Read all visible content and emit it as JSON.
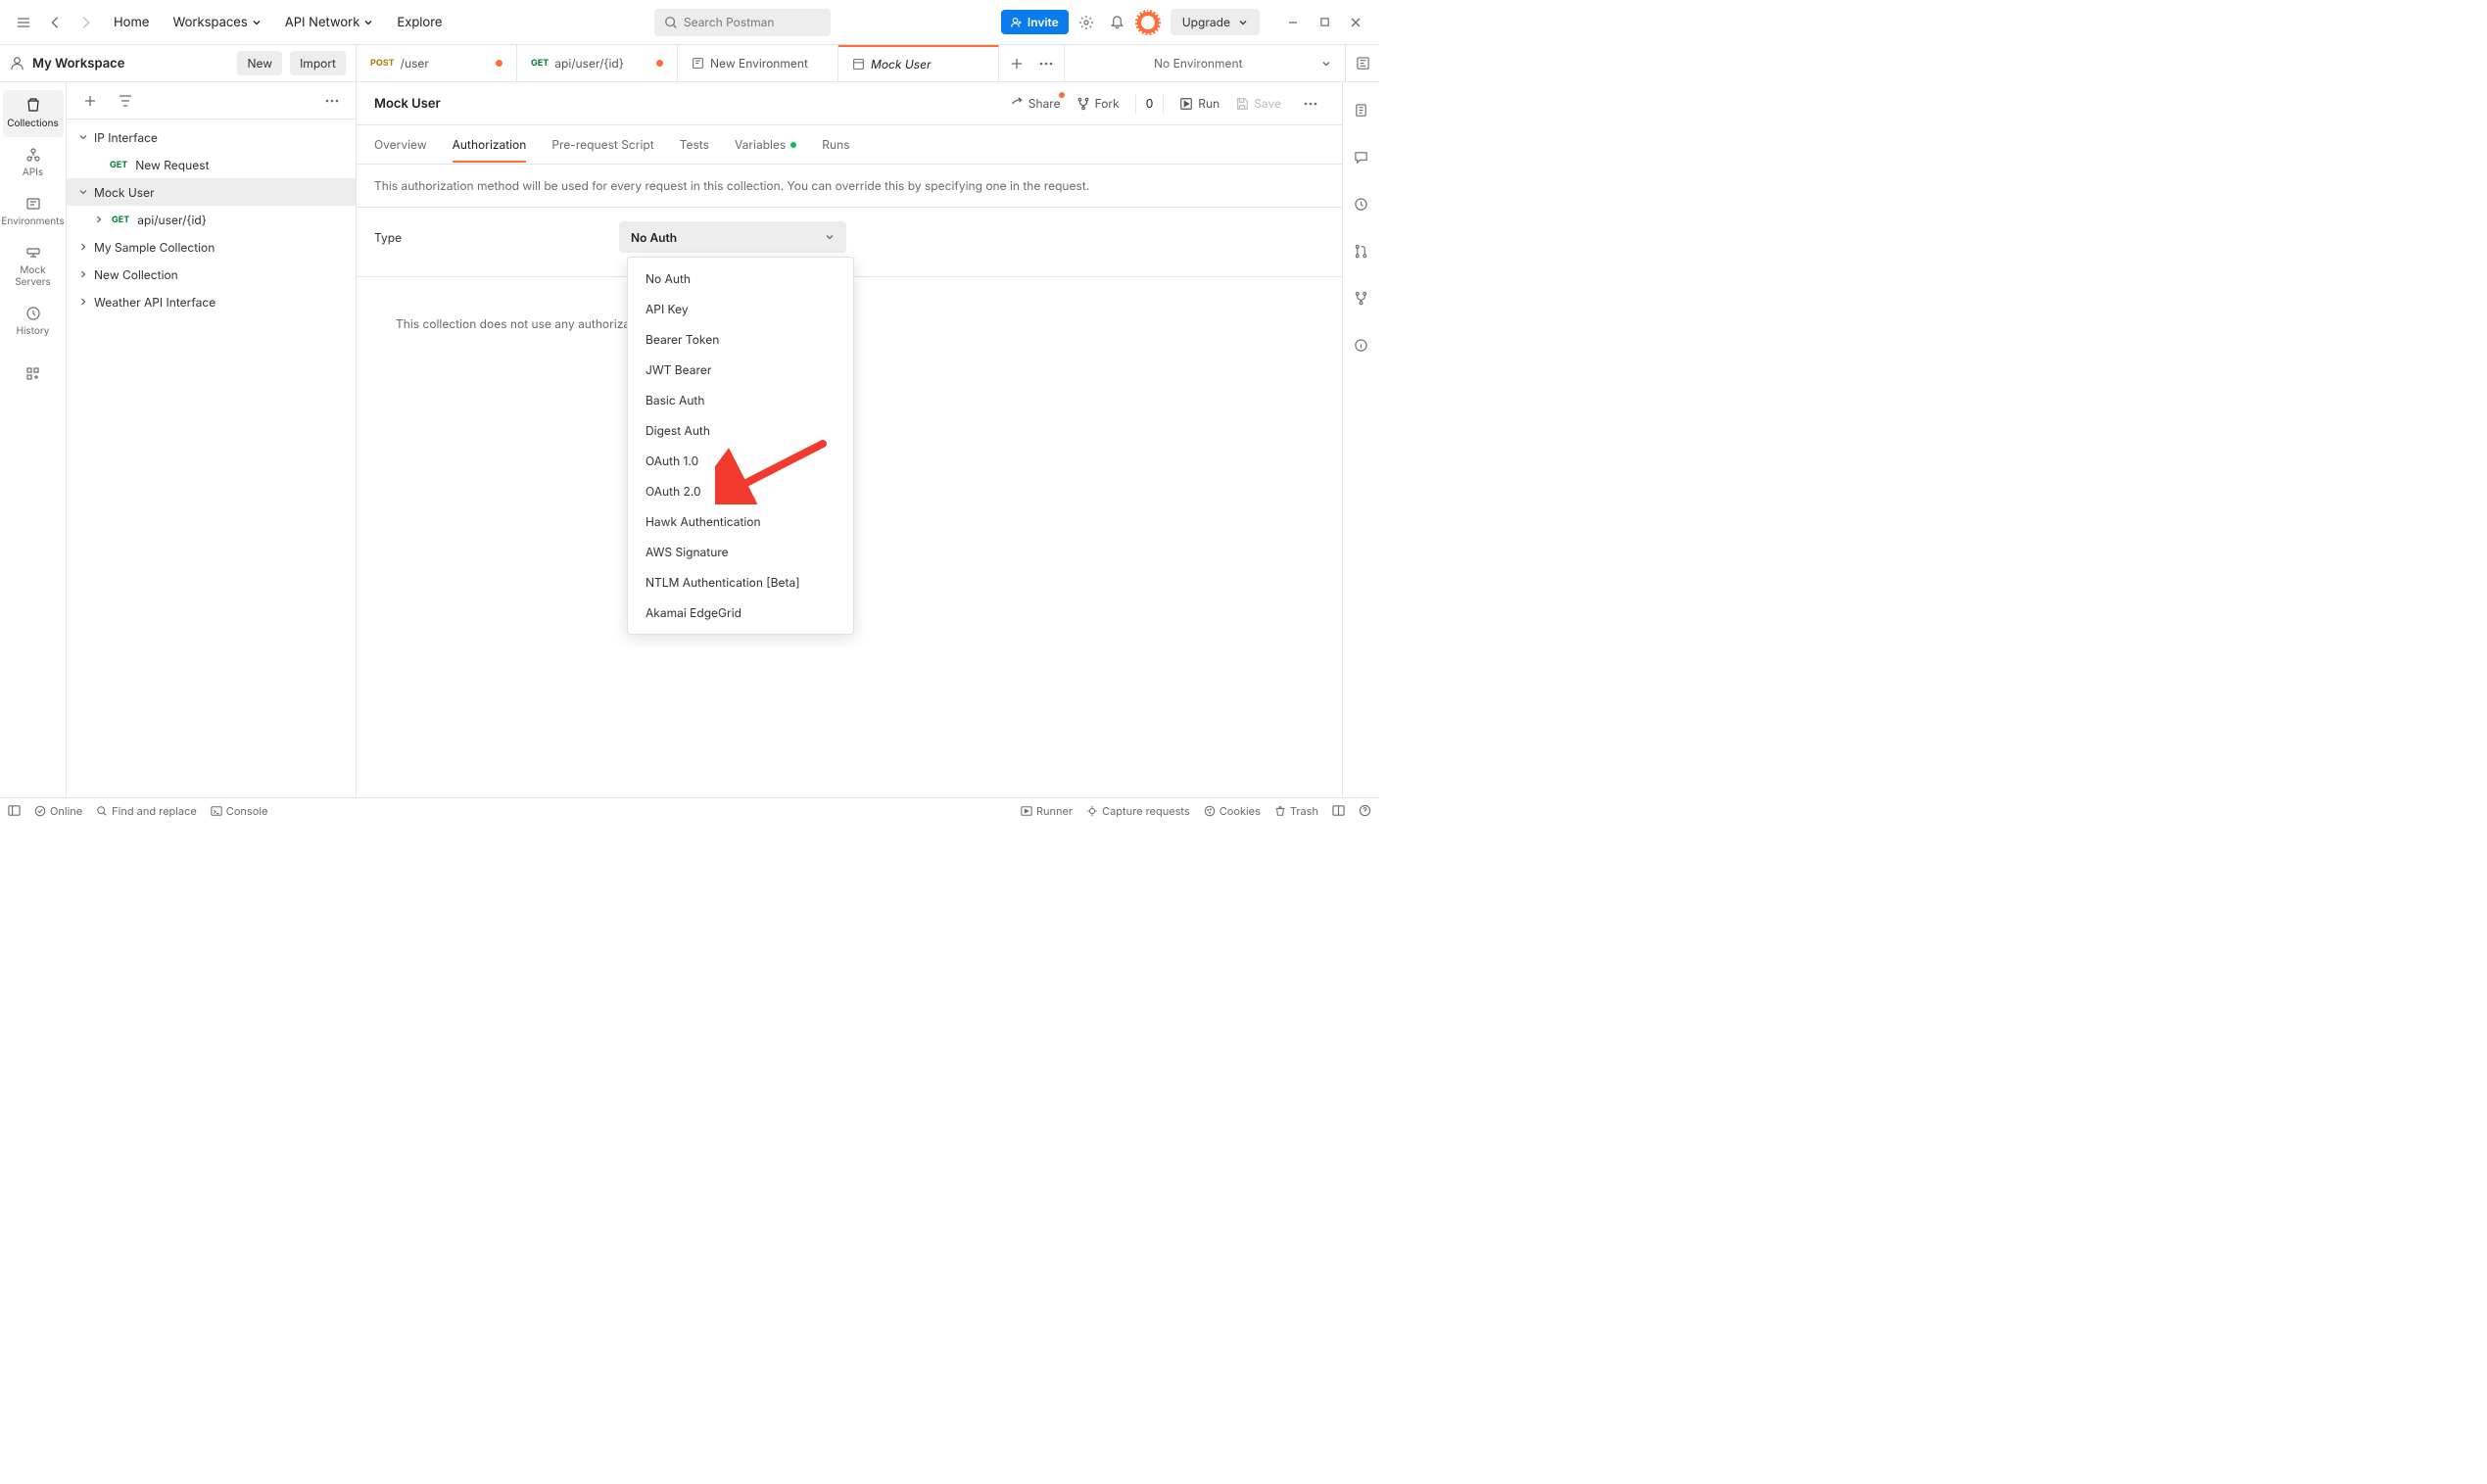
{
  "topnav": {
    "home": "Home",
    "workspaces": "Workspaces",
    "api_network": "API Network",
    "explore": "Explore",
    "search_placeholder": "Search Postman",
    "invite": "Invite",
    "upgrade": "Upgrade"
  },
  "workspace": {
    "title": "My Workspace",
    "new_btn": "New",
    "import_btn": "Import"
  },
  "tabs": [
    {
      "method": "POST",
      "method_color": "#AD7A03",
      "label": "/user",
      "dirty": true
    },
    {
      "method": "GET",
      "method_color": "#007F31",
      "label": "api/user/{id}",
      "dirty": true
    },
    {
      "icon": "env",
      "label": "New Environment",
      "dirty": false
    },
    {
      "icon": "collection",
      "label": "Mock User",
      "dirty": false,
      "active": true,
      "italic": true
    }
  ],
  "env_selector": "No Environment",
  "left_rail": [
    {
      "label": "Collections",
      "active": true
    },
    {
      "label": "APIs"
    },
    {
      "label": "Environments"
    },
    {
      "label": "Mock Servers"
    },
    {
      "label": "History"
    }
  ],
  "tree": [
    {
      "type": "folder",
      "label": "IP Interface",
      "expanded": true,
      "depth": 1
    },
    {
      "type": "request",
      "method": "GET",
      "label": "New Request",
      "depth": 2
    },
    {
      "type": "folder",
      "label": "Mock User",
      "expanded": true,
      "selected": true,
      "depth": 1
    },
    {
      "type": "folder-sub",
      "method": "GET",
      "label": "api/user/{id}",
      "depth": 2,
      "chev": true
    },
    {
      "type": "folder",
      "label": "My Sample Collection",
      "expanded": false,
      "depth": 1
    },
    {
      "type": "folder",
      "label": "New Collection",
      "expanded": false,
      "depth": 1
    },
    {
      "type": "folder",
      "label": "Weather API Interface",
      "expanded": false,
      "depth": 1
    }
  ],
  "main": {
    "title": "Mock User",
    "actions": {
      "share": "Share",
      "fork": "Fork",
      "fork_count": "0",
      "run": "Run",
      "save": "Save"
    },
    "subtabs": [
      {
        "label": "Overview"
      },
      {
        "label": "Authorization",
        "active": true
      },
      {
        "label": "Pre-request Script"
      },
      {
        "label": "Tests"
      },
      {
        "label": "Variables",
        "dot": true
      },
      {
        "label": "Runs"
      }
    ],
    "auth_desc": "This authorization method will be used for every request in this collection. You can override this by specifying one in the request.",
    "type_label": "Type",
    "type_value": "No Auth",
    "auth_empty": "This collection does not use any authoriza",
    "auth_dropdown": [
      "No Auth",
      "API Key",
      "Bearer Token",
      "JWT Bearer",
      "Basic Auth",
      "Digest Auth",
      "OAuth 1.0",
      "OAuth 2.0",
      "Hawk Authentication",
      "AWS Signature",
      "NTLM Authentication [Beta]",
      "Akamai EdgeGrid"
    ]
  },
  "footer": {
    "online": "Online",
    "find": "Find and replace",
    "console": "Console",
    "runner": "Runner",
    "capture": "Capture requests",
    "cookies": "Cookies",
    "trash": "Trash"
  }
}
